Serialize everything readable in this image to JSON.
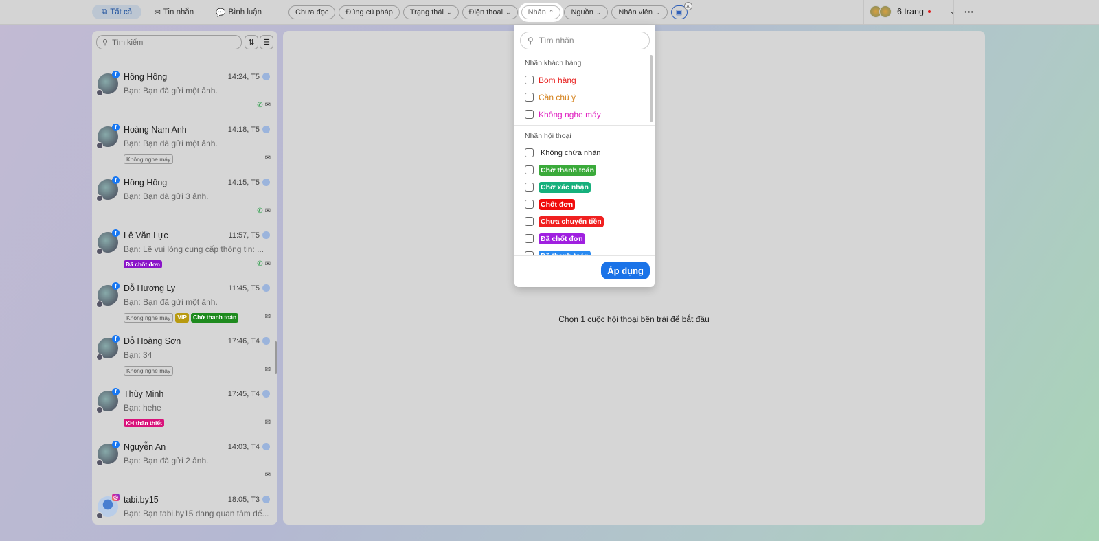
{
  "header": {
    "tabs": [
      {
        "label": "Tất cả",
        "icon": "copy-icon",
        "active": true
      },
      {
        "label": "Tin nhắn",
        "icon": "mail-icon"
      },
      {
        "label": "Bình luận",
        "icon": "comment-icon"
      }
    ],
    "filters": [
      {
        "label": "Chưa đọc"
      },
      {
        "label": "Đúng cú pháp"
      },
      {
        "label": "Trạng thái",
        "caret": "⌄"
      },
      {
        "label": "Điện thoại",
        "caret": "⌄"
      },
      {
        "label": "Nhãn",
        "caret": "⌃",
        "open": true
      },
      {
        "label": "Nguồn",
        "caret": "⌄"
      },
      {
        "label": "Nhân viên",
        "caret": "⌄"
      }
    ],
    "pages_label": "6 trang",
    "more": "···"
  },
  "sidebar": {
    "search_placeholder": "Tìm kiếm",
    "conversations": [
      {
        "name": "Hồng Hồng",
        "time": "14:24, T5",
        "preview": "Bạn: Bạn đã gửi một ảnh.",
        "source": "facebook",
        "tags": [],
        "phone": true
      },
      {
        "name": "Hoàng Nam Anh",
        "time": "14:18, T5",
        "preview": "Bạn: Bạn đã gửi một ảnh.",
        "source": "facebook",
        "tags": [
          {
            "text": "Không nghe máy",
            "outline": true
          }
        ],
        "phone": false
      },
      {
        "name": "Hồng Hồng",
        "time": "14:15, T5",
        "preview": "Bạn: Bạn đã gửi 3 ảnh.",
        "source": "facebook",
        "tags": [],
        "phone": true
      },
      {
        "name": "Lê Văn Lực",
        "time": "11:57, T5",
        "preview": "Bạn: Lê vui lòng cung cấp thông tin: ...",
        "source": "facebook",
        "tags": [
          {
            "text": "Đã chốt đơn",
            "color": "#8a14c8"
          }
        ],
        "phone": true
      },
      {
        "name": "Đỗ Hương Ly",
        "time": "11:45, T5",
        "preview": "Bạn: Bạn đã gửi một ảnh.",
        "source": "facebook",
        "tags": [
          {
            "text": "Không nghe máy",
            "outline": true
          },
          {
            "text": "VIP",
            "color": "#b89a10"
          },
          {
            "text": "Chờ thanh toán",
            "color": "#1e8a1e"
          }
        ],
        "phone": false
      },
      {
        "name": "Đỗ Hoàng Sơn",
        "time": "17:46, T4",
        "preview": "Bạn: 34",
        "source": "facebook",
        "tags": [
          {
            "text": "Không nghe máy",
            "outline": true
          }
        ],
        "phone": false
      },
      {
        "name": "Thùy Minh",
        "time": "17:45, T4",
        "preview": "Bạn: hehe",
        "source": "facebook",
        "tags": [
          {
            "text": "KH thân thiết",
            "color": "#d8127a"
          }
        ],
        "phone": false
      },
      {
        "name": "Nguyễn An",
        "time": "14:03, T4",
        "preview": "Bạn: Bạn đã gửi 2 ảnh.",
        "source": "facebook",
        "tags": [],
        "phone": false
      },
      {
        "name": "tabi.by15",
        "time": "18:05, T3",
        "preview": "Bạn: Bạn tabi.by15 đang quan tâm đế...",
        "source": "instagram",
        "tags": [],
        "phone": false
      }
    ]
  },
  "main": {
    "empty_text": "Chọn 1 cuộc hội thoại bên trái để bắt đầu"
  },
  "label_dropdown": {
    "search_placeholder": "Tìm nhãn",
    "customer_section": "Nhãn khách hàng",
    "customer_labels": [
      {
        "text": "Bom hàng",
        "color": "#e8201e"
      },
      {
        "text": "Cần chú ý",
        "color": "#d4801a"
      },
      {
        "text": "Không nghe máy",
        "color": "#e020c0"
      }
    ],
    "conversation_section": "Nhãn hội thoại",
    "no_label": "Không chứa nhãn",
    "conversation_labels": [
      {
        "text": "Chờ thanh toán",
        "color": "#3aaa3a"
      },
      {
        "text": "Chờ xác nhận",
        "color": "#16b07c"
      },
      {
        "text": "Chốt đơn",
        "color": "#f00c0c"
      },
      {
        "text": "Chưa chuyển tiền",
        "color": "#f02020"
      },
      {
        "text": "Đã chốt đơn",
        "color": "#a020e0"
      },
      {
        "text": "Đã thanh toán",
        "color": "#2a8af0"
      }
    ],
    "apply_label": "Áp dụng"
  }
}
